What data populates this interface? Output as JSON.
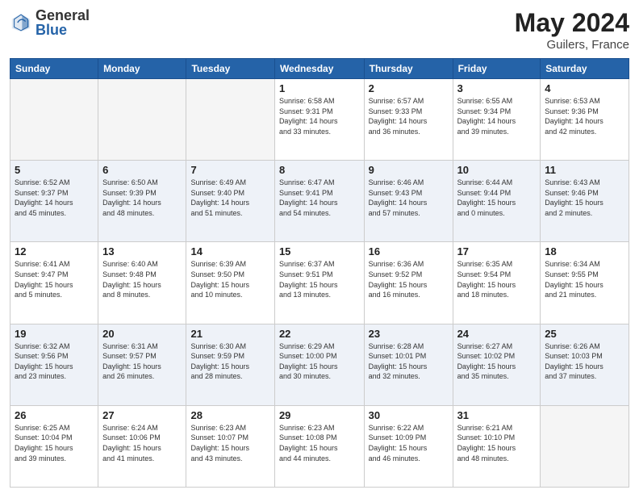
{
  "logo": {
    "general": "General",
    "blue": "Blue"
  },
  "header": {
    "month": "May 2024",
    "location": "Guilers, France"
  },
  "weekdays": [
    "Sunday",
    "Monday",
    "Tuesday",
    "Wednesday",
    "Thursday",
    "Friday",
    "Saturday"
  ],
  "weeks": [
    [
      {
        "day": "",
        "info": ""
      },
      {
        "day": "",
        "info": ""
      },
      {
        "day": "",
        "info": ""
      },
      {
        "day": "1",
        "info": "Sunrise: 6:58 AM\nSunset: 9:31 PM\nDaylight: 14 hours\nand 33 minutes."
      },
      {
        "day": "2",
        "info": "Sunrise: 6:57 AM\nSunset: 9:33 PM\nDaylight: 14 hours\nand 36 minutes."
      },
      {
        "day": "3",
        "info": "Sunrise: 6:55 AM\nSunset: 9:34 PM\nDaylight: 14 hours\nand 39 minutes."
      },
      {
        "day": "4",
        "info": "Sunrise: 6:53 AM\nSunset: 9:36 PM\nDaylight: 14 hours\nand 42 minutes."
      }
    ],
    [
      {
        "day": "5",
        "info": "Sunrise: 6:52 AM\nSunset: 9:37 PM\nDaylight: 14 hours\nand 45 minutes."
      },
      {
        "day": "6",
        "info": "Sunrise: 6:50 AM\nSunset: 9:39 PM\nDaylight: 14 hours\nand 48 minutes."
      },
      {
        "day": "7",
        "info": "Sunrise: 6:49 AM\nSunset: 9:40 PM\nDaylight: 14 hours\nand 51 minutes."
      },
      {
        "day": "8",
        "info": "Sunrise: 6:47 AM\nSunset: 9:41 PM\nDaylight: 14 hours\nand 54 minutes."
      },
      {
        "day": "9",
        "info": "Sunrise: 6:46 AM\nSunset: 9:43 PM\nDaylight: 14 hours\nand 57 minutes."
      },
      {
        "day": "10",
        "info": "Sunrise: 6:44 AM\nSunset: 9:44 PM\nDaylight: 15 hours\nand 0 minutes."
      },
      {
        "day": "11",
        "info": "Sunrise: 6:43 AM\nSunset: 9:46 PM\nDaylight: 15 hours\nand 2 minutes."
      }
    ],
    [
      {
        "day": "12",
        "info": "Sunrise: 6:41 AM\nSunset: 9:47 PM\nDaylight: 15 hours\nand 5 minutes."
      },
      {
        "day": "13",
        "info": "Sunrise: 6:40 AM\nSunset: 9:48 PM\nDaylight: 15 hours\nand 8 minutes."
      },
      {
        "day": "14",
        "info": "Sunrise: 6:39 AM\nSunset: 9:50 PM\nDaylight: 15 hours\nand 10 minutes."
      },
      {
        "day": "15",
        "info": "Sunrise: 6:37 AM\nSunset: 9:51 PM\nDaylight: 15 hours\nand 13 minutes."
      },
      {
        "day": "16",
        "info": "Sunrise: 6:36 AM\nSunset: 9:52 PM\nDaylight: 15 hours\nand 16 minutes."
      },
      {
        "day": "17",
        "info": "Sunrise: 6:35 AM\nSunset: 9:54 PM\nDaylight: 15 hours\nand 18 minutes."
      },
      {
        "day": "18",
        "info": "Sunrise: 6:34 AM\nSunset: 9:55 PM\nDaylight: 15 hours\nand 21 minutes."
      }
    ],
    [
      {
        "day": "19",
        "info": "Sunrise: 6:32 AM\nSunset: 9:56 PM\nDaylight: 15 hours\nand 23 minutes."
      },
      {
        "day": "20",
        "info": "Sunrise: 6:31 AM\nSunset: 9:57 PM\nDaylight: 15 hours\nand 26 minutes."
      },
      {
        "day": "21",
        "info": "Sunrise: 6:30 AM\nSunset: 9:59 PM\nDaylight: 15 hours\nand 28 minutes."
      },
      {
        "day": "22",
        "info": "Sunrise: 6:29 AM\nSunset: 10:00 PM\nDaylight: 15 hours\nand 30 minutes."
      },
      {
        "day": "23",
        "info": "Sunrise: 6:28 AM\nSunset: 10:01 PM\nDaylight: 15 hours\nand 32 minutes."
      },
      {
        "day": "24",
        "info": "Sunrise: 6:27 AM\nSunset: 10:02 PM\nDaylight: 15 hours\nand 35 minutes."
      },
      {
        "day": "25",
        "info": "Sunrise: 6:26 AM\nSunset: 10:03 PM\nDaylight: 15 hours\nand 37 minutes."
      }
    ],
    [
      {
        "day": "26",
        "info": "Sunrise: 6:25 AM\nSunset: 10:04 PM\nDaylight: 15 hours\nand 39 minutes."
      },
      {
        "day": "27",
        "info": "Sunrise: 6:24 AM\nSunset: 10:06 PM\nDaylight: 15 hours\nand 41 minutes."
      },
      {
        "day": "28",
        "info": "Sunrise: 6:23 AM\nSunset: 10:07 PM\nDaylight: 15 hours\nand 43 minutes."
      },
      {
        "day": "29",
        "info": "Sunrise: 6:23 AM\nSunset: 10:08 PM\nDaylight: 15 hours\nand 44 minutes."
      },
      {
        "day": "30",
        "info": "Sunrise: 6:22 AM\nSunset: 10:09 PM\nDaylight: 15 hours\nand 46 minutes."
      },
      {
        "day": "31",
        "info": "Sunrise: 6:21 AM\nSunset: 10:10 PM\nDaylight: 15 hours\nand 48 minutes."
      },
      {
        "day": "",
        "info": ""
      }
    ]
  ]
}
